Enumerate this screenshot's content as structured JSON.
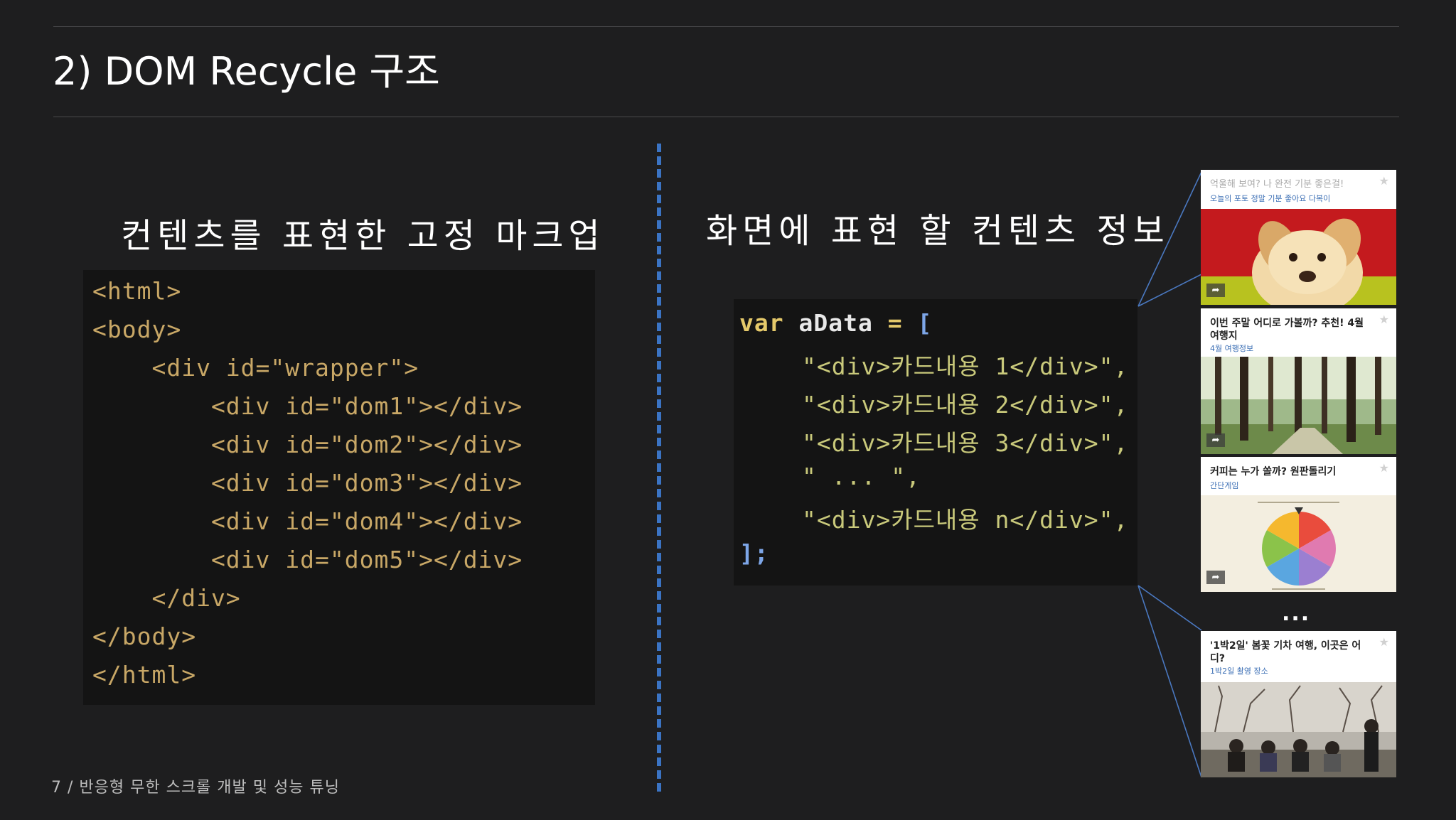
{
  "slide": {
    "title": "2) DOM Recycle 구조",
    "left_heading": "컨텐츠를 표현한 고정 마크업",
    "right_heading": "화면에 표현 할 컨텐츠 정보",
    "footer": "7 / 반응형 무한 스크롤 개발 및 성능 튜닝"
  },
  "markup_code": [
    "<html>",
    "<body>",
    "    <div id=\"wrapper\">",
    "        <div id=\"dom1\"></div>",
    "        <div id=\"dom2\"></div>",
    "        <div id=\"dom3\"></div>",
    "        <div id=\"dom4\"></div>",
    "        <div id=\"dom5\"></div>",
    "    </div>",
    "</body>",
    "</html>"
  ],
  "data_code": {
    "decl_keyword": "var",
    "decl_name": "aData",
    "decl_op": "=",
    "open_bracket": "[",
    "items": [
      "\"<div>카드내용 1</div>\",",
      "\"<div>카드내용 2</div>\",",
      "\"<div>카드내용 3</div>\",",
      "\" ... \",",
      "\"<div>카드내용 n</div>\","
    ],
    "close": "];"
  },
  "cards": [
    {
      "title": "억울해 보여? 나 완전 기분 좋은걸!",
      "subtitle": "오늘의 포토   정말 기분 좋아요   다복이"
    },
    {
      "title": "이번 주말 어디로 가볼까? 추천! 4월 여행지",
      "subtitle": "4월 여행정보"
    },
    {
      "title": "커피는 누가 쏠까? 원판돌리기",
      "subtitle": "간단게임"
    },
    {
      "title": "'1박2일' 봄꽃 기차 여행, 이곳은 어디?",
      "subtitle": "1박2일 촬영 장소"
    }
  ],
  "cards_ellipsis": "...",
  "icons": {
    "share": "share-icon",
    "star": "star-icon"
  },
  "colors": {
    "background": "#1e1e1f",
    "divider": "#3b74c4",
    "code_bg": "#141414",
    "markup_text": "#c8a766",
    "string_text": "#c9c97b"
  }
}
